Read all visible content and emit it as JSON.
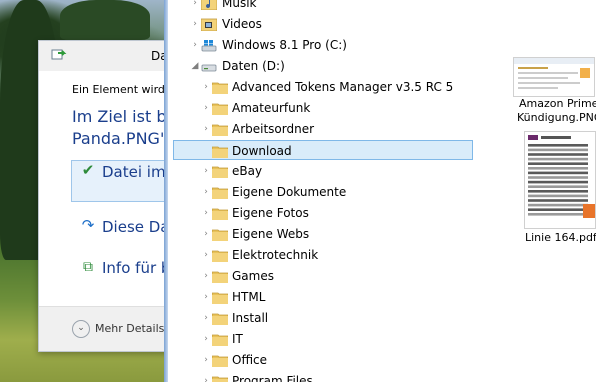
{
  "dialog": {
    "title": "Da",
    "info": "Ein Element wird ",
    "heading_line1": "Im Ziel ist ber",
    "heading_line2": "Panda.PNG\" v",
    "options": [
      {
        "icon": "check-icon",
        "label": "Datei im "
      },
      {
        "icon": "skip-icon",
        "label": "Diese Da"
      },
      {
        "icon": "compare-icon",
        "label": "Info für b"
      }
    ],
    "more_details": "Mehr Details"
  },
  "tree": {
    "items": [
      {
        "label": "Musik",
        "icon": "music-folder-icon",
        "expander": "›"
      },
      {
        "label": "Videos",
        "icon": "videos-folder-icon",
        "expander": "›"
      },
      {
        "label": "Windows 8.1 Pro (C:)",
        "icon": "windows-drive-icon",
        "expander": "›"
      },
      {
        "label": "Daten (D:)",
        "icon": "drive-icon",
        "expander": "◢"
      },
      {
        "label": "Advanced Tokens Manager v3.5 RC 5",
        "icon": "folder-icon",
        "expander": "›"
      },
      {
        "label": "Amateurfunk",
        "icon": "folder-icon",
        "expander": "›"
      },
      {
        "label": "Arbeitsordner",
        "icon": "folder-icon",
        "expander": "›"
      },
      {
        "label": "Download",
        "icon": "folder-icon",
        "expander": ""
      },
      {
        "label": "eBay",
        "icon": "folder-icon",
        "expander": "›"
      },
      {
        "label": "Eigene Dokumente",
        "icon": "folder-icon",
        "expander": "›"
      },
      {
        "label": "Eigene Fotos",
        "icon": "folder-icon",
        "expander": "›"
      },
      {
        "label": "Eigene Webs",
        "icon": "folder-icon",
        "expander": "›"
      },
      {
        "label": "Elektrotechnik",
        "icon": "folder-icon",
        "expander": "›"
      },
      {
        "label": "Games",
        "icon": "folder-icon",
        "expander": "›"
      },
      {
        "label": "HTML",
        "icon": "folder-icon",
        "expander": "›"
      },
      {
        "label": "Install",
        "icon": "folder-icon",
        "expander": "›"
      },
      {
        "label": "IT",
        "icon": "folder-icon",
        "expander": "›"
      },
      {
        "label": "Office",
        "icon": "folder-icon",
        "expander": "›"
      },
      {
        "label": "Program Files",
        "icon": "folder-icon",
        "expander": "›"
      }
    ],
    "selected": "Download"
  },
  "files": [
    {
      "name_line1": "Amazon Prime",
      "name_line2": "Kündigung.PNG"
    },
    {
      "name_line1": "Linie 164.pdf",
      "name_line2": ""
    }
  ],
  "colors": {
    "accent": "#1a3e8c",
    "selection": "#d9ecfa",
    "selection_border": "#7fb8e8",
    "folder_yellow": "#e8c25a"
  }
}
